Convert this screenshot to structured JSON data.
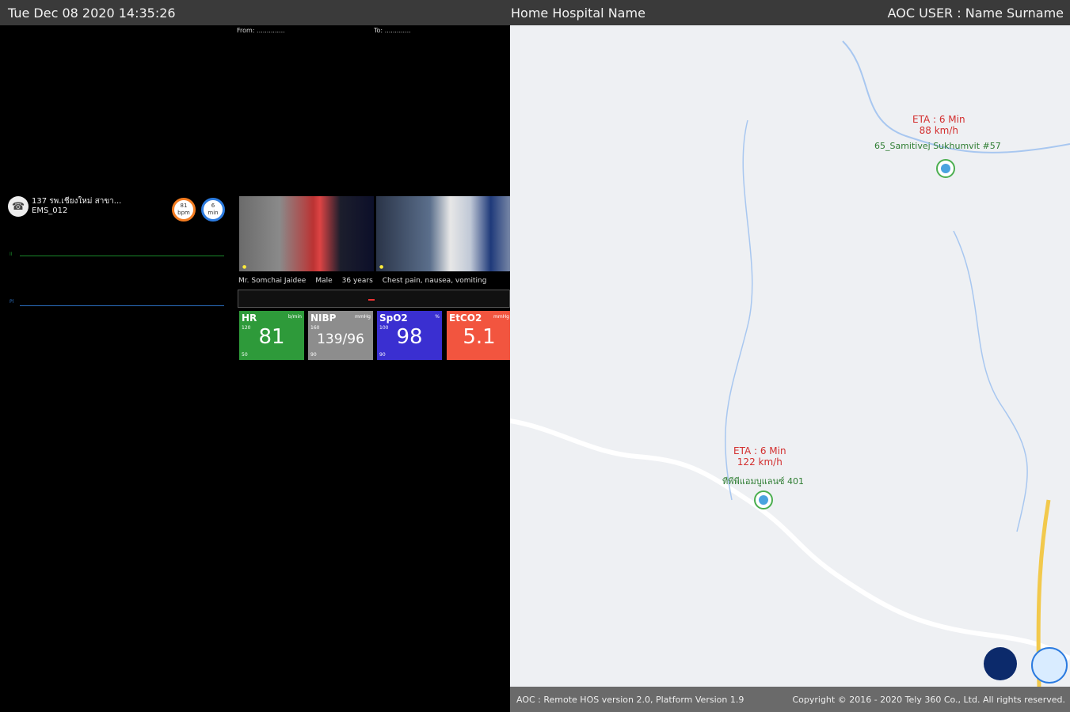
{
  "header": {
    "datetime": "Tue Dec 08 2020 14:35:26",
    "hospital": "Home Hospital Name",
    "user": "AOC USER : Name Surname"
  },
  "route": {
    "from": "From: ..............",
    "to": "To: ............."
  },
  "ambulance": {
    "name": "137 รพ.เชียงใหม่ สาขา...",
    "code": "EMS_012",
    "badge_hr": {
      "value": "81",
      "unit": "bpm"
    },
    "badge_spo2": {
      "value": "6",
      "unit": "min"
    }
  },
  "patient": {
    "name": "Mr. Somchai Jaidee",
    "sex": "Male",
    "age": "36 years",
    "complaint": "Chest pain, nausea, vomiting"
  },
  "vitals": [
    {
      "name": "HR",
      "unit": "b/min",
      "hi": "120",
      "lo": "50",
      "value": "81",
      "color": "#2e9a3a"
    },
    {
      "name": "NIBP",
      "unit": "mmHg",
      "hi": "160",
      "lo": "90",
      "value": "139/96",
      "color": "#8d8d8d"
    },
    {
      "name": "SpO2",
      "unit": "%",
      "hi": "100",
      "lo": "90",
      "value": "98",
      "color": "#3a2fd1"
    },
    {
      "name": "EtCO2",
      "unit": "mmHg",
      "hi": "",
      "lo": "",
      "value": "5.1",
      "color": "#f2553f"
    }
  ],
  "map": {
    "unit1": {
      "eta": "ETA : 6 Min",
      "speed": "88 km/h",
      "name": "65_Samitivej Sukhumvit #57"
    },
    "unit2": {
      "eta": "ETA : 6 Min",
      "speed": "122 km/h",
      "name": "ทีพีพีแอมบูแลนซ์ 401"
    }
  },
  "footer": {
    "version": "AOC : Remote HOS version 2.0, Platform Version 1.9",
    "copyright": "Copyright © 2016 - 2020 Tely 360 Co., Ltd. All rights reserved."
  }
}
